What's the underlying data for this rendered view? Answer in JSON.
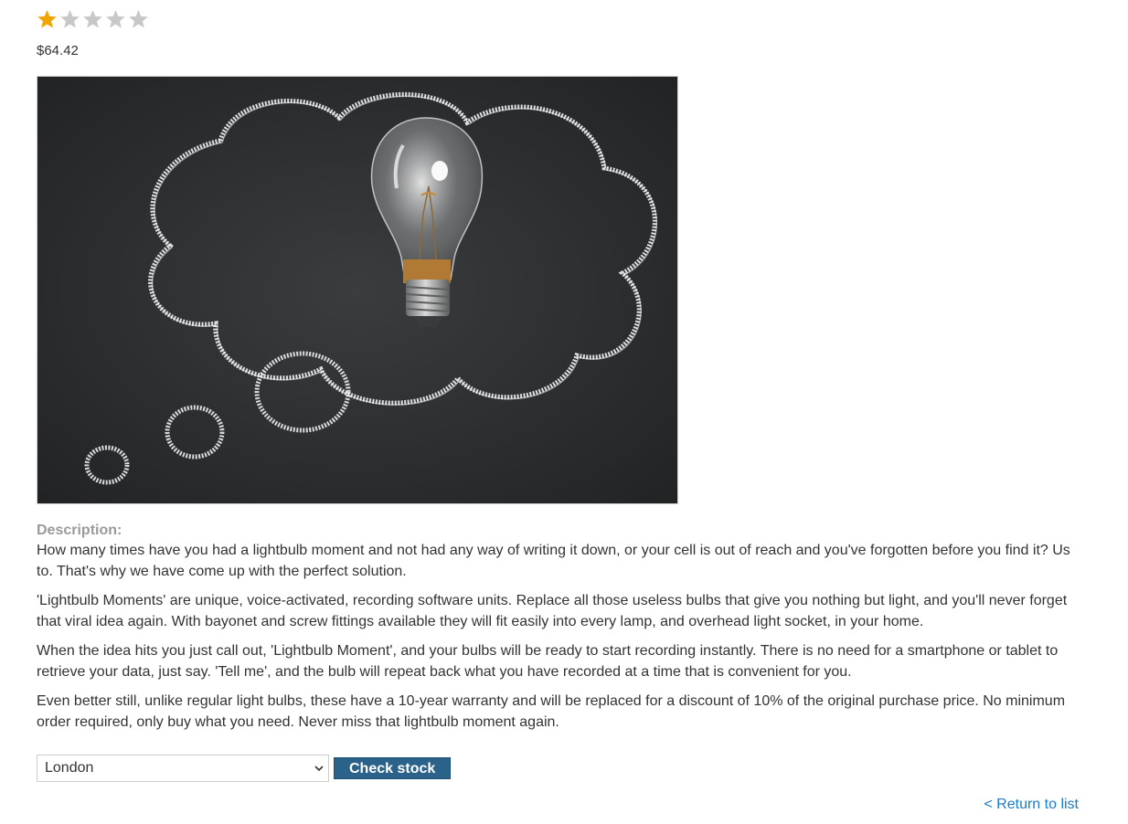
{
  "product": {
    "rating": 1,
    "rating_max": 5,
    "price": "$64.42",
    "image_alt": "Lightbulb in a chalk thought bubble on a blackboard"
  },
  "description": {
    "label": "Description:",
    "paragraphs": [
      "How many times have you had a lightbulb moment and not had any way of writing it down, or your cell is out of reach and you've forgotten before you find it? Us to. That's why we have come up with the perfect solution.",
      "'Lightbulb Moments' are unique, voice-activated, recording software units. Replace all those useless bulbs that give you nothing but light, and you'll never forget that viral idea again. With bayonet and screw fittings available they will fit easily into every lamp, and overhead light socket, in your home.",
      "When the idea hits you just call out, 'Lightbulb Moment', and your bulbs will be ready to start recording instantly. There is no need for a smartphone or tablet to retrieve your data, just say. 'Tell me', and the bulb will repeat back what you have recorded at a time that is convenient for you.",
      "Even better still, unlike regular light bulbs, these have a 10-year warranty and will be replaced for a discount of 10% of the original purchase price. No minimum order required, only buy what you need. Never miss that lightbulb moment again."
    ]
  },
  "stock": {
    "selected_store": "London",
    "check_button_label": "Check stock"
  },
  "nav": {
    "return_link": "< Return to list"
  },
  "colors": {
    "star_filled": "#f0a500",
    "star_empty": "#c8c8c8",
    "button_bg": "#2a6289",
    "link": "#1b7bc6"
  },
  "icons": {
    "rating": "star-icon",
    "select": "chevron-down-icon"
  }
}
